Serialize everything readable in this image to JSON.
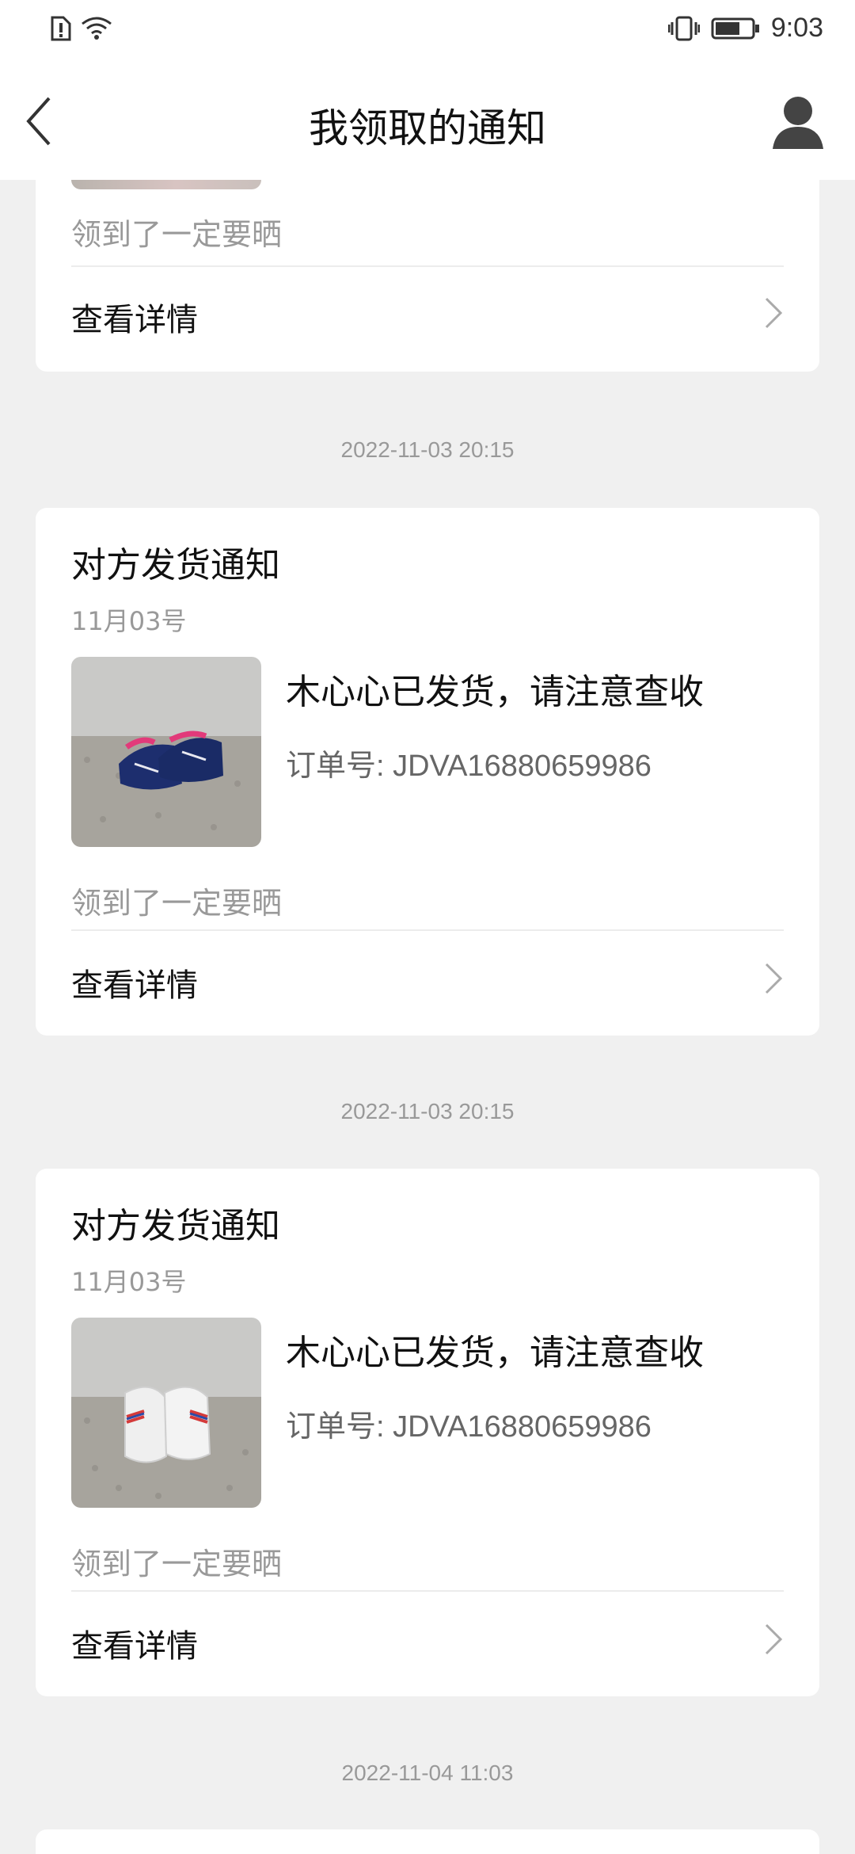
{
  "status_bar": {
    "time": "9:03",
    "left_icons": [
      "alert-icon",
      "wifi-icon"
    ],
    "right_icons": [
      "vibrate-icon",
      "battery-icon"
    ]
  },
  "header": {
    "title": "我领取的通知",
    "back_icon": "back-icon",
    "user_icon": "user-icon"
  },
  "partial_card": {
    "note": "领到了一定要晒",
    "detail_label": "查看详情"
  },
  "notifications": [
    {
      "timestamp": "2022-11-03 20:15",
      "title": "对方发货通知",
      "date": "11月03号",
      "message": "木心心已发货，请注意查收",
      "order": "订单号: JDVA16880659986",
      "note": "领到了一定要晒",
      "detail_label": "查看详情",
      "image": "shoe-blue-pink"
    },
    {
      "timestamp": "2022-11-03 20:15",
      "title": "对方发货通知",
      "date": "11月03号",
      "message": "木心心已发货，请注意查收",
      "order": "订单号: JDVA16880659986",
      "note": "领到了一定要晒",
      "detail_label": "查看详情",
      "image": "shoe-white"
    }
  ],
  "next_timestamp": "2022-11-04 11:03",
  "colors": {
    "background": "#f0f0f0",
    "card": "#ffffff",
    "primary_text": "#111111",
    "secondary_text": "#999999",
    "order_text": "#666666"
  }
}
